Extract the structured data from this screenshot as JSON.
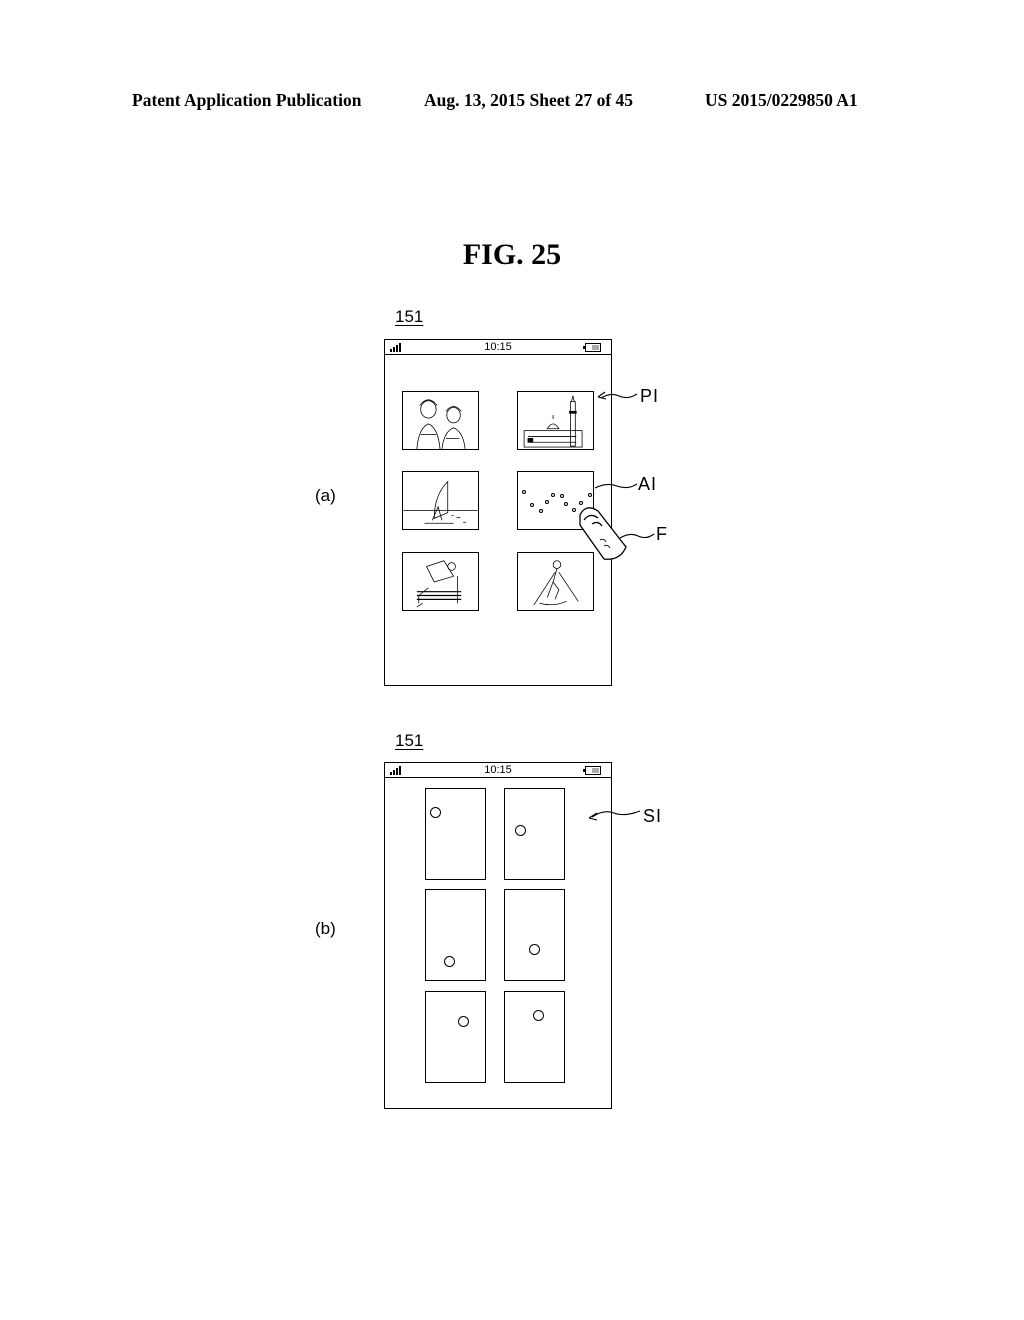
{
  "header": {
    "publication": "Patent Application Publication",
    "date_sheet": "Aug. 13, 2015  Sheet 27 of 45",
    "patent_number": "US 2015/0229850 A1"
  },
  "figure": {
    "title": "FIG. 25"
  },
  "panel_a": {
    "label": "(a)",
    "device_ref": "151",
    "status_bar": {
      "time": "10:15",
      "signal_icon": "signal-bars-icon",
      "battery_icon": "battery-icon"
    },
    "thumbnails": [
      {
        "subject": "two women portrait sketch"
      },
      {
        "subject": "mosque with minaret"
      },
      {
        "subject": "windsurfer"
      },
      {
        "subject": "animated image dots",
        "note": "being touched by finger"
      },
      {
        "subject": "person reading newspaper on bench"
      },
      {
        "subject": "skier"
      }
    ],
    "callouts": {
      "pi": "PI",
      "ai": "AI",
      "f": "F"
    }
  },
  "panel_b": {
    "label": "(b)",
    "device_ref": "151",
    "status_bar": {
      "time": "10:15",
      "signal_icon": "signal-bars-icon",
      "battery_icon": "battery-icon"
    },
    "frames_count": 6,
    "callouts": {
      "si": "SI"
    }
  }
}
